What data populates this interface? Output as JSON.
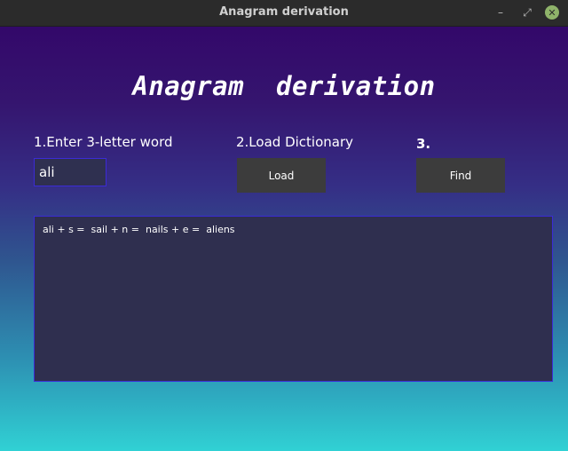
{
  "window": {
    "title": "Anagram  derivation",
    "minimize_glyph": "–",
    "restore_glyph": "⤢",
    "close_glyph": "✕"
  },
  "main": {
    "heading": "Anagram  derivation",
    "step1_label": "1.Enter 3-letter word",
    "word_value": "ali",
    "step2_label": "2.Load Dictionary",
    "load_button": "Load",
    "step3_label": "3.",
    "find_button": "Find",
    "output_text": "ali + s =  sail + n =  nails + e =  aliens"
  },
  "colors": {
    "titlebar": "#2b2b2b",
    "gradient_top": "#33086a",
    "gradient_bottom": "#30d1d4",
    "field_background": "#2f2f4f",
    "field_border": "#3b2bd6",
    "button_background": "#3c3c3c",
    "close_button": "#8fb36a"
  }
}
